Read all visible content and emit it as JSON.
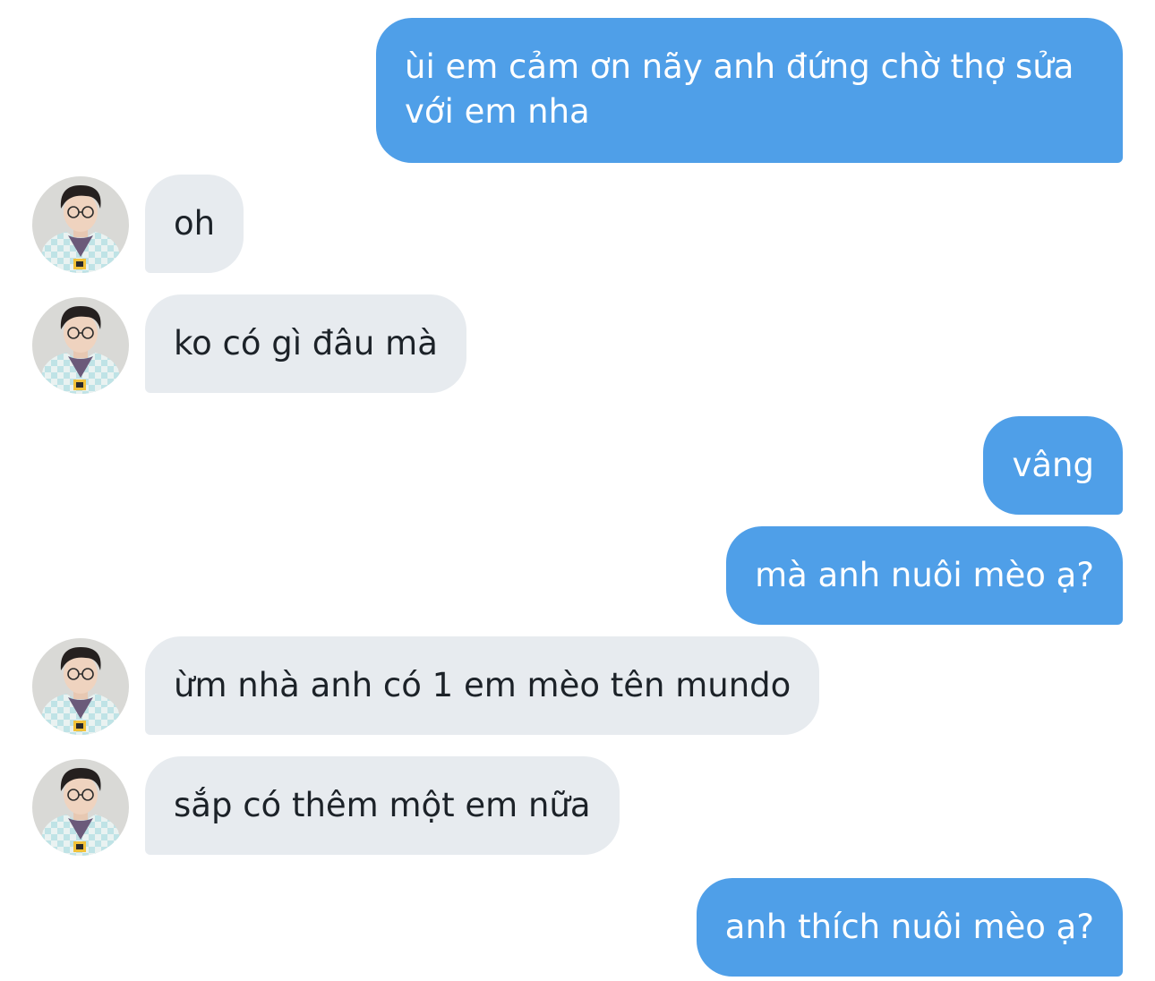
{
  "thread": {
    "messages": [
      {
        "direction": "sent",
        "text": "ùi em cảm ơn nãy anh đứng chờ thợ sửa với em nha"
      },
      {
        "direction": "received",
        "text": "oh"
      },
      {
        "direction": "received",
        "text": "ko có gì đâu mà"
      },
      {
        "direction": "sent",
        "text": "vâng"
      },
      {
        "direction": "sent",
        "text": "mà anh nuôi mèo ạ?"
      },
      {
        "direction": "received",
        "text": "ừm nhà anh có 1 em mèo tên mundo"
      },
      {
        "direction": "received",
        "text": "sắp có thêm một em nữa"
      },
      {
        "direction": "sent",
        "text": "anh thích nuôi mèo ạ?"
      }
    ]
  },
  "colors": {
    "sent_bubble": "#4f9fe8",
    "sent_text": "#ffffff",
    "received_bubble": "#e7ebef",
    "received_text": "#1c2228",
    "background": "#ffffff"
  },
  "icons": {
    "contact_avatar": "user-avatar-photo"
  }
}
